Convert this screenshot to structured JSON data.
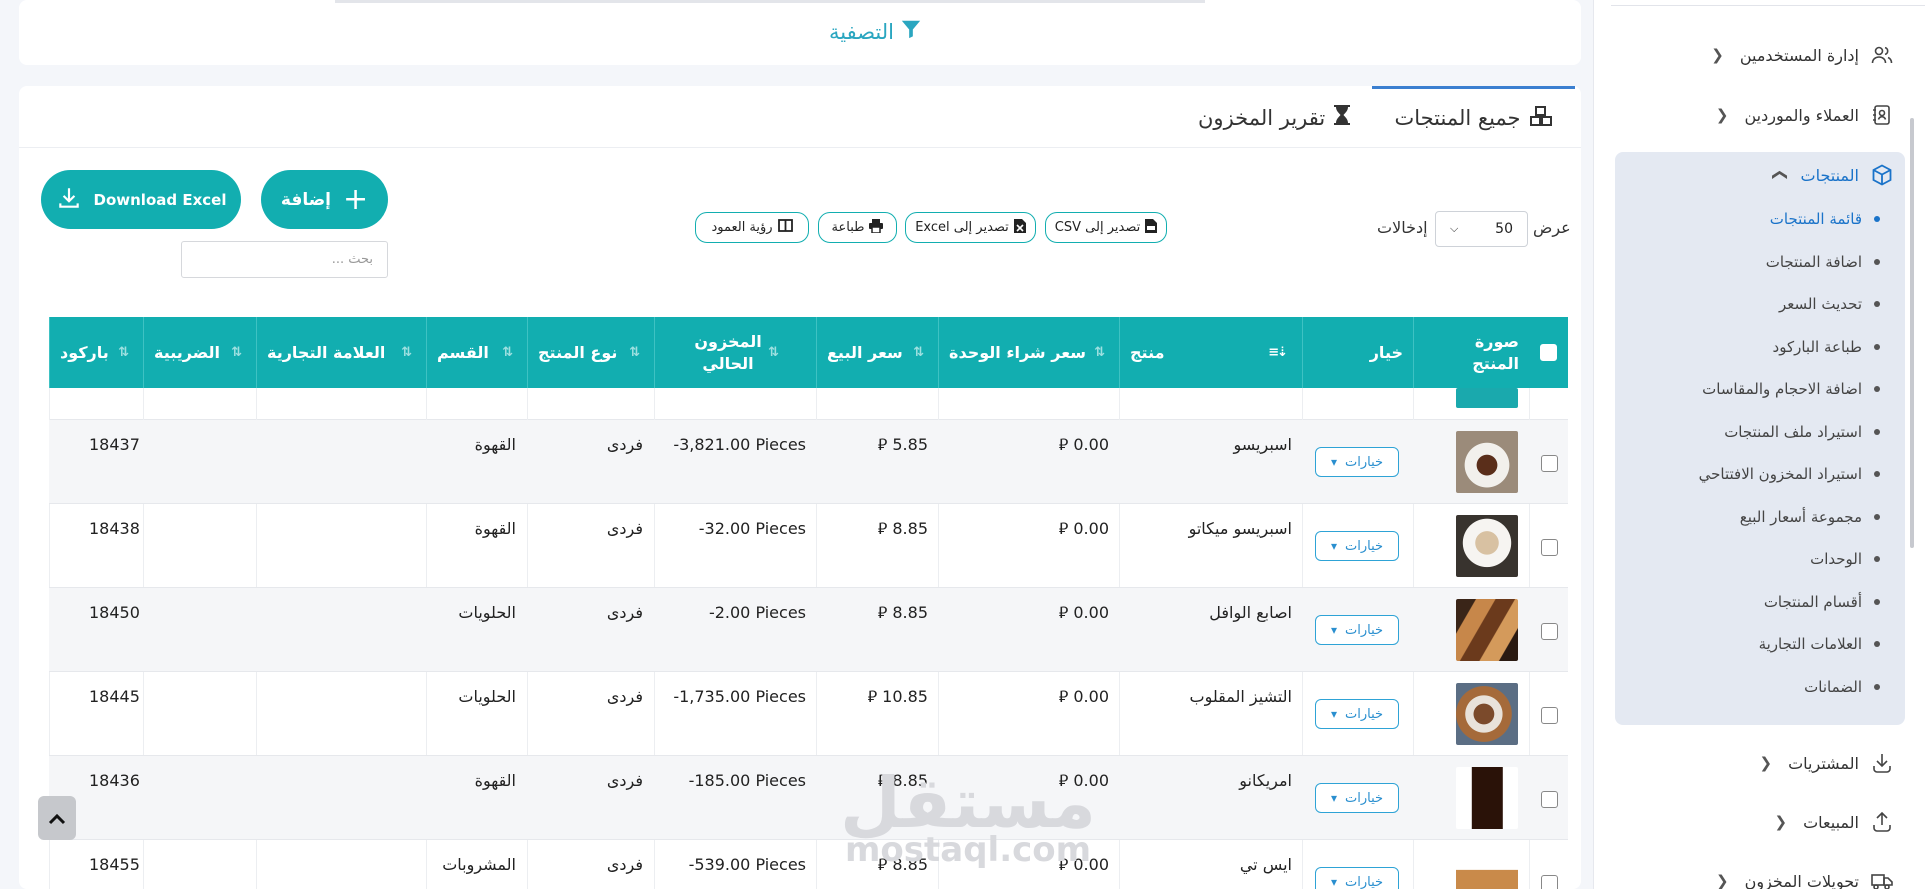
{
  "sidebar": {
    "items": [
      {
        "label": "إدارة المستخدمين"
      },
      {
        "label": "العملاء والموردين"
      },
      {
        "label": "المنتجات"
      },
      {
        "label": "المشتريات"
      },
      {
        "label": "المبيعات"
      },
      {
        "label": "تحويلات المخزون"
      }
    ],
    "sub_items": [
      {
        "label": "قائمة المنتجات"
      },
      {
        "label": "اضافة المنتجات"
      },
      {
        "label": "تحديث السعر"
      },
      {
        "label": "طباعة الباركود"
      },
      {
        "label": "اضافة الاحجام والمقاسات"
      },
      {
        "label": "استيراد ملف المنتجات"
      },
      {
        "label": "استيراد المخزون الافتتاحي"
      },
      {
        "label": "مجموعة أسعار البيع"
      },
      {
        "label": "الوحدات"
      },
      {
        "label": "أقسام المنتجات"
      },
      {
        "label": "العلامات التجارية"
      },
      {
        "label": "الضمانات"
      }
    ]
  },
  "filter": {
    "title": "التصفية"
  },
  "tabs": [
    {
      "label": "جميع المنتجات"
    },
    {
      "label": "تقرير المخزون"
    }
  ],
  "actions": {
    "download_excel": "Download Excel",
    "add": "إضافة",
    "search_placeholder": "بحث ...",
    "export_csv": "تصدير إلى CSV",
    "export_excel": "تصدير إلى Excel",
    "print": "طباعة",
    "column_visibility": "رؤية العمود"
  },
  "entries": {
    "show": "عرض",
    "value": "50",
    "suffix": "إدخالات"
  },
  "table": {
    "headers": {
      "image": "صورة المنتج",
      "option": "خيار",
      "product": "منتج",
      "unit_cost": "سعر شراء الوحدة",
      "price": "سعر البيع",
      "stock": "المخزون الحالي",
      "type": "نوع المنتج",
      "category": "القسم",
      "brand": "العلامة التجارية",
      "tax": "الضريبية",
      "barcode": "باركود"
    },
    "options_label": "خيارات",
    "currency_symbol": "⃁",
    "rows": [
      {
        "product": "اسبريسو",
        "unit_cost": "0.00",
        "price": "5.85",
        "stock": "-3,821.00 Pieces",
        "type": "فردى",
        "category": "القهوة",
        "brand": "",
        "tax": "",
        "barcode": "18437"
      },
      {
        "product": "اسبريسو ميكاتو",
        "unit_cost": "0.00",
        "price": "8.85",
        "stock": "-32.00 Pieces",
        "type": "فردى",
        "category": "القهوة",
        "brand": "",
        "tax": "",
        "barcode": "18438"
      },
      {
        "product": "اصابع الوافل",
        "unit_cost": "0.00",
        "price": "8.85",
        "stock": "-2.00 Pieces",
        "type": "فردى",
        "category": "الحلويات",
        "brand": "",
        "tax": "",
        "barcode": "18450"
      },
      {
        "product": "التشيز المقلوب",
        "unit_cost": "0.00",
        "price": "10.85",
        "stock": "-1,735.00 Pieces",
        "type": "فردى",
        "category": "الحلويات",
        "brand": "",
        "tax": "",
        "barcode": "18445"
      },
      {
        "product": "امريكانو",
        "unit_cost": "0.00",
        "price": "8.85",
        "stock": "-185.00 Pieces",
        "type": "فردى",
        "category": "القهوة",
        "brand": "",
        "tax": "",
        "barcode": "18436"
      },
      {
        "product": "ايس تي",
        "unit_cost": "0.00",
        "price": "8.85",
        "stock": "-539.00 Pieces",
        "type": "فردى",
        "category": "المشروبات",
        "brand": "",
        "tax": "",
        "barcode": "18455"
      }
    ]
  },
  "watermark": {
    "arabic": "مستقل",
    "latin": "mostaql.com"
  },
  "colors": {
    "accent": "#12aeb0",
    "link": "#1a73c9"
  }
}
